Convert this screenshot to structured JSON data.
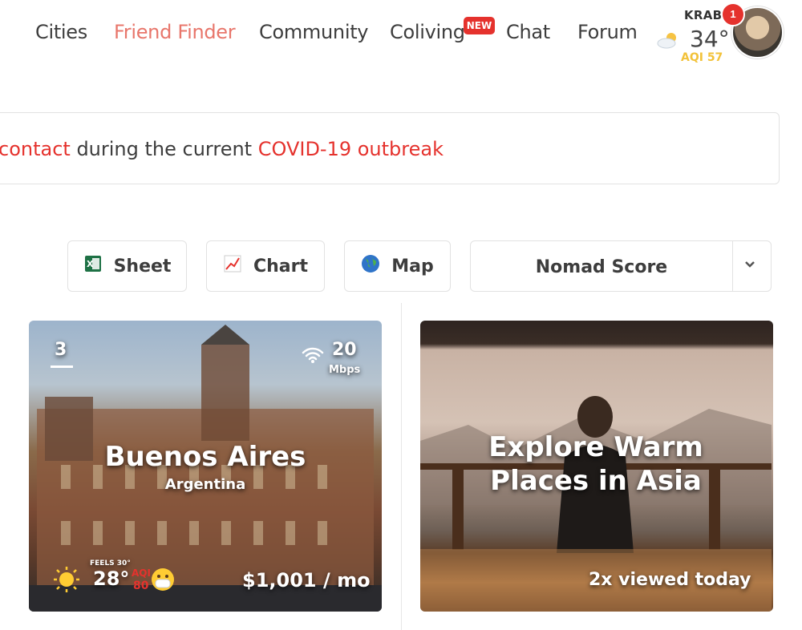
{
  "nav": {
    "items": [
      {
        "label": "Cities"
      },
      {
        "label": "Friend Finder"
      },
      {
        "label": "Community"
      },
      {
        "label": "Coliving"
      },
      {
        "label": "Chat"
      },
      {
        "label": "Forum"
      }
    ],
    "new_badge": "NEW"
  },
  "weather": {
    "city": "KRABI",
    "temp": "34°",
    "aqi": "AQI 57",
    "icon": "partly-cloudy-icon"
  },
  "user": {
    "notifications": "1"
  },
  "banner": {
    "part1": "contact",
    "part2": " during the current ",
    "part3": "COVID-19 outbreak"
  },
  "toolbar": {
    "sheet_label": "Sheet",
    "chart_label": "Chart",
    "map_label": "Map",
    "sort_label": "Nomad Score"
  },
  "cards": [
    {
      "rank": "3",
      "wifi_speed": "20",
      "wifi_unit": "Mbps",
      "city": "Buenos Aires",
      "country": "Argentina",
      "feels": "FEELS 30°",
      "temp": "28°",
      "aqi_label": "AQI",
      "aqi_value": "80",
      "cost": "$1,001 / mo"
    },
    {
      "title_line1": "Explore Warm",
      "title_line2": "Places in Asia",
      "views": "2x viewed today"
    }
  ],
  "colors": {
    "accent": "#e8766b",
    "red": "#e5322d",
    "aqi_yellow": "#f2c23a"
  }
}
